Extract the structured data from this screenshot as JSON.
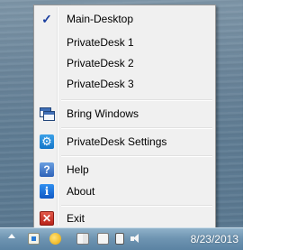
{
  "menu": {
    "items": [
      {
        "label": "Main-Desktop",
        "icon": "check-icon",
        "checked": true
      },
      {
        "label": "PrivateDesk 1"
      },
      {
        "label": "PrivateDesk 2"
      },
      {
        "label": "PrivateDesk 3"
      },
      {
        "label": "Bring Windows",
        "icon": "bring-windows-icon"
      },
      {
        "label": "PrivateDesk Settings",
        "icon": "gear-icon"
      },
      {
        "label": "Help",
        "icon": "help-icon"
      },
      {
        "label": "About",
        "icon": "info-icon"
      },
      {
        "label": "Exit",
        "icon": "exit-icon"
      }
    ],
    "check_glyph": "✓",
    "gear_glyph": "⚙",
    "help_glyph": "?",
    "info_glyph": "i",
    "exit_glyph": "✕"
  },
  "taskbar": {
    "clock": "8/23/2013"
  }
}
